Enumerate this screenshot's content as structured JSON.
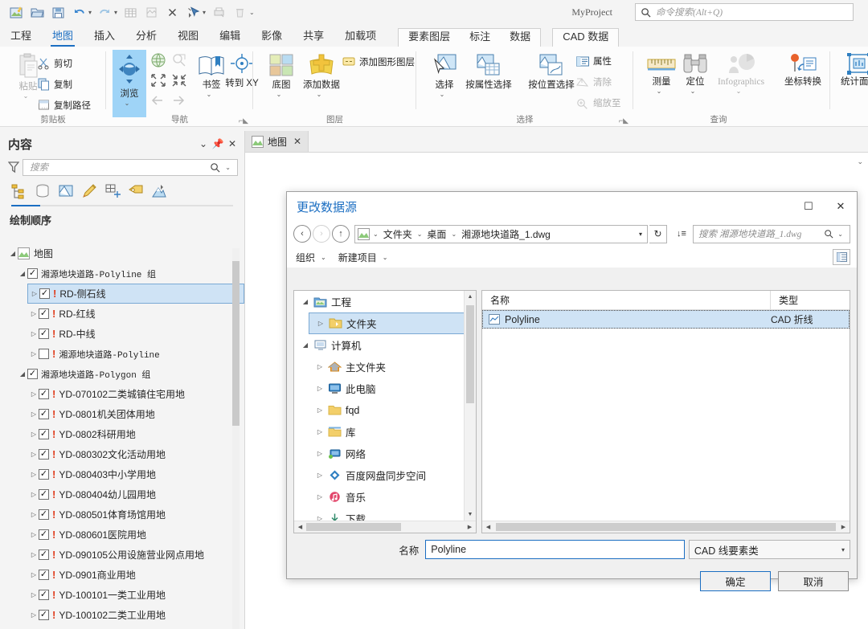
{
  "app": {
    "project_name": "MyProject",
    "command_search_placeholder": "命令搜索(Alt+Q)"
  },
  "quick_access": {
    "buttons": [
      {
        "name": "new-project-icon",
        "title": "新建工程"
      },
      {
        "name": "open-project-icon",
        "title": "打开工程"
      },
      {
        "name": "save-project-icon",
        "title": "保存工程"
      },
      {
        "name": "undo-icon",
        "title": "撤消"
      },
      {
        "name": "redo-icon",
        "title": "恢复"
      },
      {
        "name": "table-icon",
        "title": "表"
      },
      {
        "name": "layout-icon",
        "title": "布局"
      },
      {
        "name": "delete-x-icon",
        "title": "删除"
      },
      {
        "name": "select-arrow-icon",
        "title": "选择"
      },
      {
        "name": "print-icon",
        "title": "打印"
      },
      {
        "name": "trash-icon",
        "title": "删除"
      },
      {
        "name": "customize-icon",
        "title": "自定义"
      }
    ]
  },
  "ribbon_tabs": [
    {
      "label": "工程",
      "active": false
    },
    {
      "label": "地图",
      "active": true
    },
    {
      "label": "插入",
      "active": false
    },
    {
      "label": "分析",
      "active": false
    },
    {
      "label": "视图",
      "active": false
    },
    {
      "label": "编辑",
      "active": false
    },
    {
      "label": "影像",
      "active": false
    },
    {
      "label": "共享",
      "active": false
    },
    {
      "label": "加载项",
      "active": false
    }
  ],
  "contextual_tabs": [
    {
      "group": "feature-layer",
      "labels": [
        "要素图层",
        "标注",
        "数据"
      ]
    },
    {
      "group": "cad-data",
      "labels": [
        "CAD 数据"
      ]
    }
  ],
  "ribbon": {
    "groups": [
      {
        "name": "剪贴板",
        "items": [
          {
            "label": "粘贴",
            "icon": "paste-icon",
            "size": "big",
            "dropdown": true,
            "disabled": true
          },
          {
            "label": "剪切",
            "icon": "cut-scissors-icon",
            "size": "small",
            "disabled": false
          },
          {
            "label": "复制",
            "icon": "copy-icon",
            "size": "small",
            "disabled": false
          },
          {
            "label": "复制路径",
            "icon": "copy-path-icon",
            "size": "small",
            "disabled": false
          }
        ]
      },
      {
        "name": "导航",
        "items": [
          {
            "label": "浏览",
            "icon": "explore-navigate-icon",
            "size": "big",
            "dropdown": true,
            "active": true
          },
          {
            "label": "",
            "icon": "full-extent-globe-icon",
            "size": "icon",
            "disabled": false
          },
          {
            "label": "",
            "icon": "zoom-to-selection-icon",
            "size": "icon",
            "disabled": true
          },
          {
            "label": "",
            "icon": "fixed-zoom-in-icon",
            "size": "icon",
            "disabled": false
          },
          {
            "label": "",
            "icon": "fixed-zoom-out-icon",
            "size": "icon",
            "disabled": false
          },
          {
            "label": "",
            "icon": "previous-extent-arrow-icon",
            "size": "icon",
            "disabled": true
          },
          {
            "label": "",
            "icon": "next-extent-arrow-icon",
            "size": "icon",
            "disabled": true
          },
          {
            "label": "书签",
            "icon": "bookmarks-icon",
            "size": "big",
            "dropdown": true
          },
          {
            "label": "转到 XY",
            "icon": "go-to-xy-icon",
            "size": "big"
          }
        ]
      },
      {
        "name": "图层",
        "items": [
          {
            "label": "底图",
            "icon": "basemap-icon",
            "size": "big",
            "dropdown": true
          },
          {
            "label": "添加数据",
            "icon": "add-data-icon",
            "size": "big",
            "dropdown": true
          },
          {
            "label": "添加图形图层",
            "icon": "add-graphics-layer-icon",
            "size": "small"
          }
        ]
      },
      {
        "name": "选择",
        "items": [
          {
            "label": "选择",
            "icon": "select-features-icon",
            "size": "big",
            "dropdown": true
          },
          {
            "label": "按属性选择",
            "icon": "select-by-attributes-icon",
            "size": "big"
          },
          {
            "label": "按位置选择",
            "icon": "select-by-location-icon",
            "size": "big"
          },
          {
            "label": "属性",
            "icon": "attributes-icon",
            "size": "small",
            "disabled": false
          },
          {
            "label": "清除",
            "icon": "clear-selection-icon",
            "size": "small",
            "disabled": true
          },
          {
            "label": "缩放至",
            "icon": "zoom-to-selection-small-icon",
            "size": "small",
            "disabled": true
          }
        ]
      },
      {
        "name": "查询",
        "items": [
          {
            "label": "测量",
            "icon": "measure-ruler-icon",
            "size": "big",
            "dropdown": true
          },
          {
            "label": "定位",
            "icon": "locate-binoculars-icon",
            "size": "big",
            "dropdown": true
          },
          {
            "label": "Infographics",
            "icon": "infographics-icon",
            "size": "big",
            "dropdown": true,
            "disabled": true
          },
          {
            "label": "坐标转换",
            "icon": "coordinate-conversion-icon",
            "size": "big"
          },
          {
            "label": "统计面积",
            "icon": "statistics-area-icon",
            "size": "big"
          }
        ]
      }
    ]
  },
  "contents_pane": {
    "title": "内容",
    "header_buttons": [
      "menu-chevron-icon",
      "pin-icon",
      "close-icon"
    ],
    "search_placeholder": "搜索",
    "tool_tabs": [
      "list-by-drawing-order-icon",
      "list-by-data-source-icon",
      "list-by-selection-icon",
      "list-by-editing-icon",
      "list-by-snapping-icon",
      "list-by-labeling-icon",
      "list-by-elevation-icon"
    ],
    "section_title": "绘制顺序",
    "tree": [
      {
        "label": "地图",
        "level": 0,
        "type": "map",
        "expander": "down",
        "checkbox": "none",
        "warning": false
      },
      {
        "label": "湘源地块道路-Polyline 组",
        "level": 1,
        "type": "group",
        "expander": "down",
        "checkbox": "checked",
        "warning": false,
        "mono": true
      },
      {
        "label": "RD-侧石线",
        "level": 2,
        "type": "layer",
        "expander": "right",
        "checkbox": "checked",
        "warning": true,
        "selected": true
      },
      {
        "label": "RD-红线",
        "level": 2,
        "type": "layer",
        "expander": "right",
        "checkbox": "checked",
        "warning": true
      },
      {
        "label": "RD-中线",
        "level": 2,
        "type": "layer",
        "expander": "right",
        "checkbox": "checked",
        "warning": true
      },
      {
        "label": "湘源地块道路-Polyline",
        "level": 2,
        "type": "layer",
        "expander": "right",
        "checkbox": "unchecked",
        "warning": true,
        "mono": true
      },
      {
        "label": "湘源地块道路-Polygon 组",
        "level": 1,
        "type": "group",
        "expander": "down",
        "checkbox": "checked",
        "warning": false,
        "mono": true
      },
      {
        "label": "YD-070102二类城镇住宅用地",
        "level": 2,
        "type": "layer",
        "expander": "right",
        "checkbox": "checked",
        "warning": true
      },
      {
        "label": "YD-0801机关团体用地",
        "level": 2,
        "type": "layer",
        "expander": "right",
        "checkbox": "checked",
        "warning": true
      },
      {
        "label": "YD-0802科研用地",
        "level": 2,
        "type": "layer",
        "expander": "right",
        "checkbox": "checked",
        "warning": true
      },
      {
        "label": "YD-080302文化活动用地",
        "level": 2,
        "type": "layer",
        "expander": "right",
        "checkbox": "checked",
        "warning": true
      },
      {
        "label": "YD-080403中小学用地",
        "level": 2,
        "type": "layer",
        "expander": "right",
        "checkbox": "checked",
        "warning": true
      },
      {
        "label": "YD-080404幼儿园用地",
        "level": 2,
        "type": "layer",
        "expander": "right",
        "checkbox": "checked",
        "warning": true
      },
      {
        "label": "YD-080501体育场馆用地",
        "level": 2,
        "type": "layer",
        "expander": "right",
        "checkbox": "checked",
        "warning": true
      },
      {
        "label": "YD-080601医院用地",
        "level": 2,
        "type": "layer",
        "expander": "right",
        "checkbox": "checked",
        "warning": true
      },
      {
        "label": "YD-090105公用设施营业网点用地",
        "level": 2,
        "type": "layer",
        "expander": "right",
        "checkbox": "checked",
        "warning": true
      },
      {
        "label": "YD-0901商业用地",
        "level": 2,
        "type": "layer",
        "expander": "right",
        "checkbox": "checked",
        "warning": true
      },
      {
        "label": "YD-100101一类工业用地",
        "level": 2,
        "type": "layer",
        "expander": "right",
        "checkbox": "checked",
        "warning": true
      },
      {
        "label": "YD-100102二类工业用地",
        "level": 2,
        "type": "layer",
        "expander": "right",
        "checkbox": "checked",
        "warning": true
      }
    ]
  },
  "map_view": {
    "tab_label": "地图",
    "tab_close": "✕"
  },
  "dialog": {
    "title": "更改数据源",
    "titlebar_buttons": [
      "maximize-icon",
      "close-icon"
    ],
    "nav": {
      "back": "‹",
      "forward": "›",
      "up": "↑",
      "breadcrumbs": [
        "文件夹",
        "桌面",
        "湘源地块道路_1.dwg"
      ],
      "refresh_icon": "refresh-icon",
      "sort_icon": "sort-icon",
      "search_placeholder": "搜索 湘源地块道路_1.dwg"
    },
    "menubar": {
      "items": [
        "组织",
        "新建项目"
      ],
      "view_button": "view-details-icon"
    },
    "tree": [
      {
        "label": "工程",
        "level": 0,
        "icon": "project-icon",
        "expander": "down"
      },
      {
        "label": "文件夹",
        "level": 1,
        "icon": "folder-icon",
        "expander": "right",
        "selected": true
      },
      {
        "label": "计算机",
        "level": 0,
        "icon": "computer-icon",
        "expander": "down"
      },
      {
        "label": "主文件夹",
        "level": 1,
        "icon": "home-icon",
        "expander": "right"
      },
      {
        "label": "此电脑",
        "level": 1,
        "icon": "this-pc-icon",
        "expander": "right"
      },
      {
        "label": "fqd",
        "level": 1,
        "icon": "folder-icon",
        "expander": "right"
      },
      {
        "label": "库",
        "level": 1,
        "icon": "library-icon",
        "expander": "right"
      },
      {
        "label": "网络",
        "level": 1,
        "icon": "network-icon",
        "expander": "right"
      },
      {
        "label": "百度网盘同步空间",
        "level": 1,
        "icon": "baidu-netdisk-icon",
        "expander": "right"
      },
      {
        "label": "音乐",
        "level": 1,
        "icon": "music-icon",
        "expander": "none"
      },
      {
        "label": "下载",
        "level": 1,
        "icon": "downloads-icon",
        "expander": "right"
      }
    ],
    "list": {
      "columns": [
        "名称",
        "类型"
      ],
      "rows": [
        {
          "name": "Polyline",
          "type": "CAD 折线",
          "icon": "cad-polyline-icon",
          "selected": true
        }
      ]
    },
    "footer": {
      "name_label": "名称",
      "name_value": "Polyline",
      "type_value": "CAD 线要素类",
      "ok_label": "确定",
      "cancel_label": "取消"
    }
  },
  "colors": {
    "accent": "#1b6ec2",
    "selection": "#cfe3f5",
    "warning": "#e03c1c",
    "ribbon_bg": "#fcfcfc",
    "pane_bg": "#f4f4f4"
  }
}
